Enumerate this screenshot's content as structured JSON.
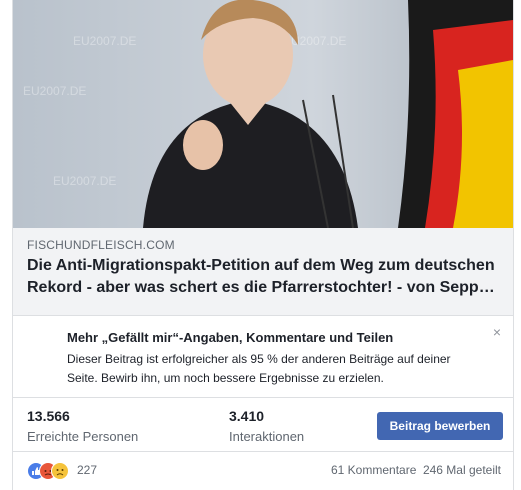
{
  "link_preview": {
    "domain": "FISCHUNDFLEISCH.COM",
    "headline_line1": "Die Anti-Migrationspakt-Petition auf dem Weg zum deutschen",
    "headline_line2": "Rekord - aber was schert es die Pfarrerstochter! - von Sepp…"
  },
  "promo": {
    "title": "Mehr „Gefällt mir“-Angaben, Kommentare und Teilen",
    "body": "Dieser Beitrag ist erfolgreicher als 95 % der anderen Beiträge auf deiner Seite. Bewirb ihn, um noch bessere Ergebnisse zu erzielen.",
    "close_label": "×"
  },
  "stats": {
    "reach_value": "13.566",
    "reach_label": "Erreichte Personen",
    "engagement_value": "3.410",
    "engagement_label": "Interaktionen",
    "boost_label": "Beitrag bewerben"
  },
  "footer": {
    "reaction_count": "227",
    "reactions": [
      "like-icon",
      "angry-icon",
      "sad-icon"
    ],
    "comments": "61 Kommentare",
    "shares": "246 Mal geteilt"
  },
  "colors": {
    "accent": "#4267b2",
    "link_bg": "#f2f3f5",
    "secondary_text": "#606770"
  }
}
